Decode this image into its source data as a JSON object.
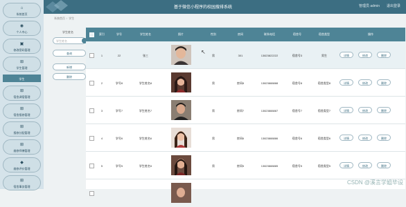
{
  "app": {
    "title": "基于微信小程序的校园搜排系统",
    "user_text": "管理员 admin",
    "logout_label": "退出登录"
  },
  "sidebar": {
    "items": [
      {
        "label": "系统首页",
        "icon": "home-icon",
        "glyph": "⌂"
      },
      {
        "label": "个人中心",
        "icon": "user-icon",
        "glyph": "◉"
      },
      {
        "label": "修改密码管理",
        "icon": "lock-icon",
        "glyph": "▣"
      },
      {
        "label": "学生管理",
        "icon": "grid-icon",
        "glyph": "⊞"
      },
      {
        "label": "学生",
        "icon": "",
        "glyph": ""
      },
      {
        "label": "宿舍调宿管理",
        "icon": "grid-icon",
        "glyph": "⊞"
      },
      {
        "label": "宿舍报修管理",
        "icon": "grid-icon",
        "glyph": "⊞"
      },
      {
        "label": "报修分配管理",
        "icon": "grid-icon",
        "glyph": "⊞"
      },
      {
        "label": "维修师傅管理",
        "icon": "grid-icon",
        "glyph": "⊞"
      },
      {
        "label": "维修评价管理",
        "icon": "star-icon",
        "glyph": "◆"
      },
      {
        "label": "宿舍事务管理",
        "icon": "grid-icon",
        "glyph": "⊞"
      }
    ]
  },
  "breadcrumb": {
    "home": "系统首页",
    "sep": "/",
    "current": "学生"
  },
  "filter": {
    "label": "学生姓名",
    "placeholder": "学生姓名",
    "search_label": "查询",
    "add_label": "新增",
    "delete_label": "删除"
  },
  "table": {
    "headers": [
      "索引",
      "学号",
      "学生姓名",
      "照片",
      "性别",
      "房间",
      "联系电话",
      "宿舍号",
      "宿舍类型",
      "操作"
    ],
    "rows": [
      {
        "index": "1",
        "student_no": "22",
        "name": "张三",
        "gender": "男",
        "room": "301",
        "phone": "13823822222",
        "dorm_no": "宿舍号3",
        "dorm_type": "男生"
      },
      {
        "index": "2",
        "student_no": "学号8",
        "name": "学生姓名8",
        "gender": "男",
        "room": "房间8",
        "phone": "13823888888",
        "dorm_no": "宿舍号8",
        "dorm_type": "宿舍类型8"
      },
      {
        "index": "3",
        "student_no": "学号7",
        "name": "学生姓名7",
        "gender": "男",
        "room": "房间7",
        "phone": "13823888887",
        "dorm_no": "宿舍号7",
        "dorm_type": "宿舍类型7"
      },
      {
        "index": "4",
        "student_no": "学号6",
        "name": "学生姓名6",
        "gender": "男",
        "room": "房间6",
        "phone": "13823888886",
        "dorm_no": "宿舍号6",
        "dorm_type": "宿舍类型6"
      },
      {
        "index": "5",
        "student_no": "学号5",
        "name": "学生姓名5",
        "gender": "男",
        "room": "房间5",
        "phone": "13823888885",
        "dorm_no": "宿舍号5",
        "dorm_type": "宿舍类型5"
      }
    ],
    "actions": {
      "detail": "详情",
      "edit": "修改",
      "delete": "删除"
    }
  },
  "watermark": "CSDN @溪言学姐毕设",
  "colors": {
    "header": "#3c6e82",
    "accent": "#4e8496",
    "sidebar": "#d5e3ea"
  }
}
